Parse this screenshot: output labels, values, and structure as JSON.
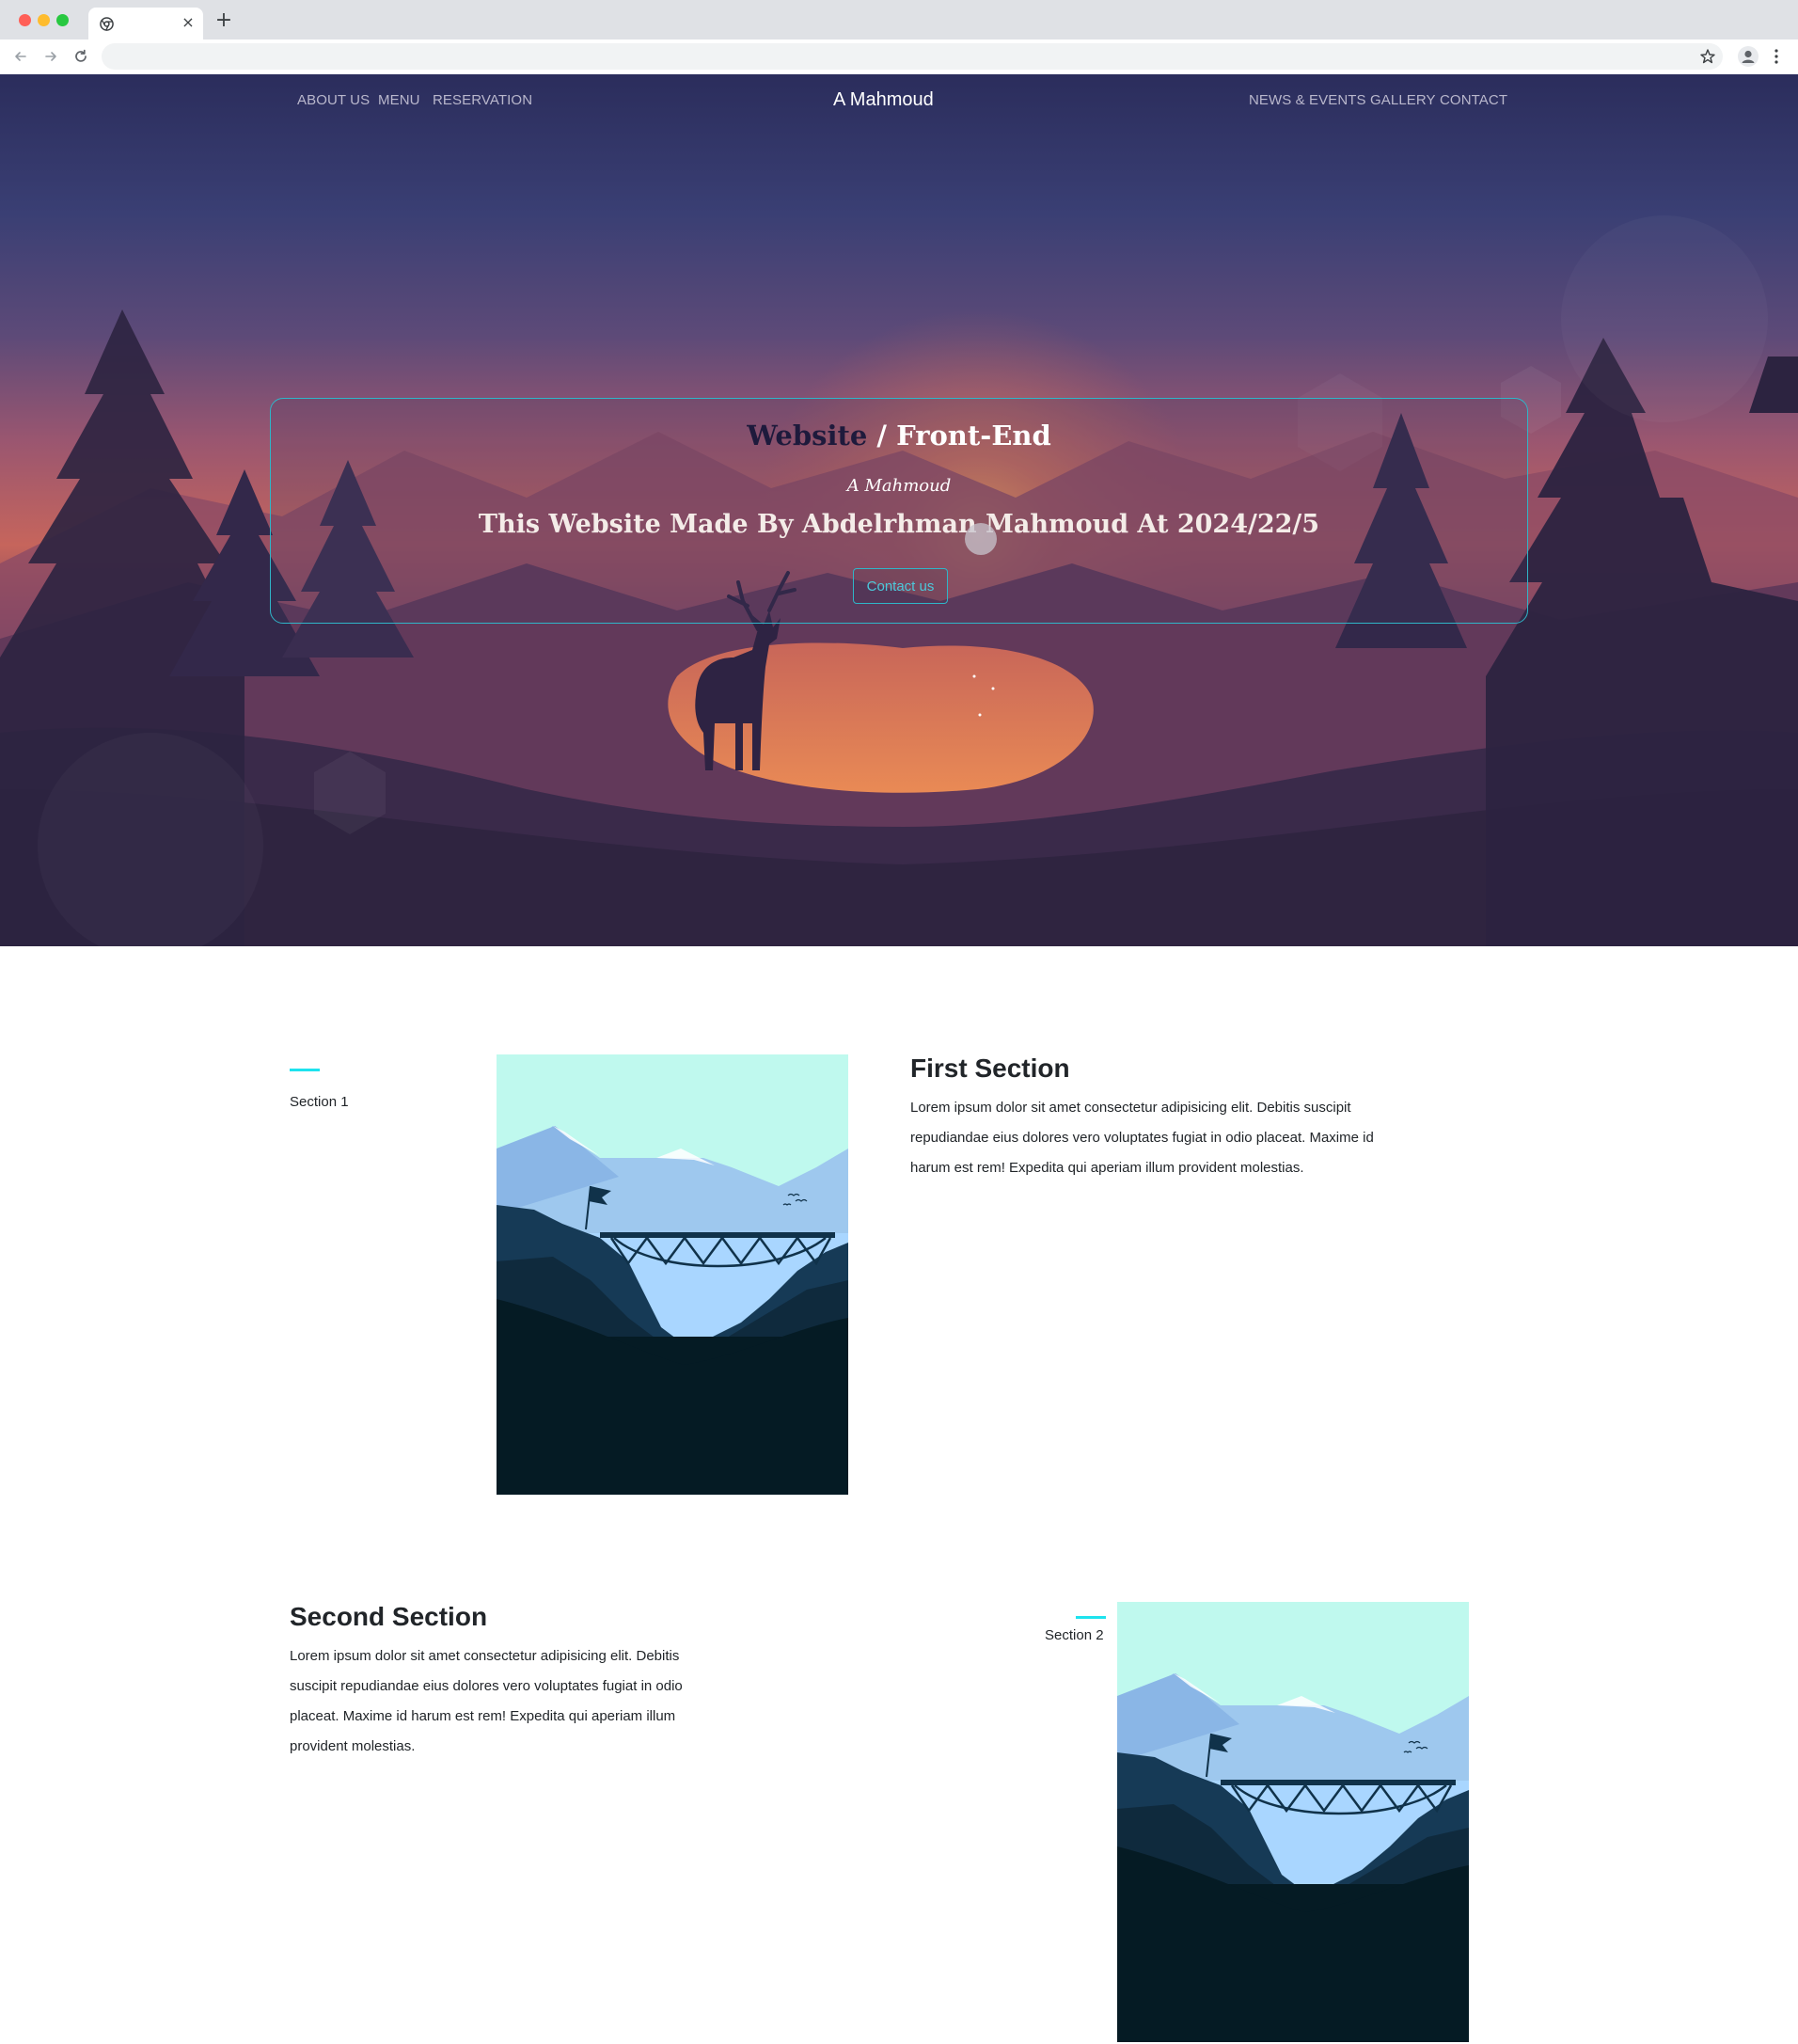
{
  "colors": {
    "accent": "#1ee3ee",
    "hero_border": "#2fb5c8",
    "hero_sky_top": "#2d3160",
    "hero_sunset": "#c8645a",
    "nav_text": "#b9b7cc"
  },
  "browser": {
    "tab_icon": "chrome-icon",
    "close_icon": "close-icon",
    "new_tab_symbol": "+",
    "close_symbol": "×"
  },
  "nav": {
    "left": [
      "ABOUT US",
      "MENU",
      "RESERVATION"
    ],
    "brand": "A Mahmoud",
    "right": [
      "NEWS & EVENTS",
      "GALLERY",
      "CONTACT"
    ]
  },
  "hero": {
    "title_left": "Website",
    "title_sep": " / ",
    "title_right": "Front-End",
    "signature": "A Mahmoud",
    "heading": "This Website Made By Abdelrhman Mahmoud At 2024/22/5",
    "button_label": "Contact us"
  },
  "sections": [
    {
      "label": "Section 1",
      "title": "First Section",
      "text": "Lorem ipsum dolor sit amet consectetur adipisicing elit. Debitis suscipit repudiandae eius dolores vero voluptates fugiat in odio placeat. Maxime id harum est rem! Expedita qui aperiam illum provident molestias."
    },
    {
      "label": "Section 2",
      "title": "Second Section",
      "text": "Lorem ipsum dolor sit amet consectetur adipisicing elit. Debitis suscipit repudiandae eius dolores vero voluptates fugiat in odio placeat. Maxime id harum est rem! Expedita qui aperiam illum provident molestias."
    }
  ]
}
